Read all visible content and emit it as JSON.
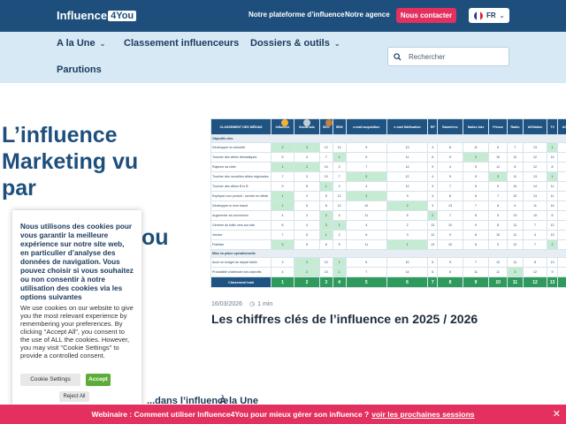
{
  "header": {
    "logo_text": "Influence",
    "logo_box": "4You",
    "links": [
      "Notre plateforme d’influence",
      "Notre agence"
    ],
    "contact_label": "Nous contacter",
    "lang_label": "FR",
    "colors": {
      "bar": "#1e4f7c",
      "accent": "#e3305f"
    }
  },
  "nav": {
    "items": [
      {
        "label": "A la Une",
        "has_dropdown": true
      },
      {
        "label": "Classement influenceurs",
        "has_dropdown": false
      },
      {
        "label": "Dossiers & outils",
        "has_dropdown": true
      },
      {
        "label": "Parutions",
        "has_dropdown": false
      }
    ],
    "search_placeholder": "Rechercher"
  },
  "hero": {
    "title_lines": [
      "L’influence",
      "Marketing vu",
      "par"
    ],
    "title_tail": "ou"
  },
  "article": {
    "date": "16/03/2026",
    "read_time": "1 min",
    "title": "Les chiffres clés de l’influence en 2025 / 2026",
    "table": {
      "headers": [
        "CLASSEMENT DES MÉDIAS",
        "Influence",
        "Social ads",
        "SEO",
        "SEM",
        "e-mail acquisition",
        "e-mail fidélisation",
        "RP",
        "Bannières",
        "Native Ads",
        "Presse",
        "Radio",
        "Affiliation",
        "TV",
        "Affichage"
      ],
      "section1": "Objectifs clés",
      "rows1": [
        {
          "label": "Développer la notoriété",
          "values": [
            "2",
            "3",
            "12",
            "10",
            "9",
            "13",
            "4",
            "8",
            "11",
            "5",
            "7",
            "13",
            "1",
            "6"
          ],
          "green": [
            0,
            1,
            12
          ]
        },
        {
          "label": "Toucher des cibles thématiques",
          "values": [
            "5",
            "4",
            "7",
            "1",
            "5",
            "11",
            "5",
            "9",
            "2",
            "10",
            "11",
            "12",
            "14",
            "15"
          ],
          "green": [
            3,
            8
          ]
        },
        {
          "label": "Rajeunir sa cible",
          "values": [
            "1",
            "2",
            "10",
            "3",
            "7",
            "14",
            "9",
            "4",
            "5",
            "11",
            "6",
            "12",
            "8",
            "13"
          ],
          "green": [
            0,
            1
          ]
        },
        {
          "label": "Toucher des nouvelles cibles régionales",
          "values": [
            "7",
            "3",
            "10",
            "7",
            "3",
            "12",
            "4",
            "9",
            "5",
            "3",
            "11",
            "13",
            "1",
            "14"
          ],
          "green": [
            4,
            9,
            12
          ]
        },
        {
          "label": "Toucher des cibles B to B",
          "values": [
            "9",
            "8",
            "1",
            "2",
            "4",
            "12",
            "3",
            "7",
            "6",
            "5",
            "10",
            "14",
            "11",
            "13"
          ],
          "green": [
            2
          ]
        },
        {
          "label": "Expliquer son produit - service en détail",
          "values": [
            "1",
            "2",
            "5",
            "12",
            "3",
            "9",
            "4",
            "8",
            "6",
            "7",
            "10",
            "13",
            "11",
            "14"
          ],
          "green": [
            0,
            4
          ]
        },
        {
          "label": "Développer le love brand",
          "values": [
            "1",
            "5",
            "8",
            "12",
            "10",
            "2",
            "3",
            "13",
            "7",
            "6",
            "4",
            "11",
            "14",
            "9"
          ],
          "green": [
            0,
            5
          ]
        },
        {
          "label": "Augmenter sa conversion",
          "values": [
            "4",
            "3",
            "2",
            "4",
            "11",
            "5",
            "2",
            "7",
            "8",
            "9",
            "13",
            "10",
            "6",
            "12"
          ],
          "green": [
            2,
            6
          ]
        },
        {
          "label": "Générer du trafic vers son site",
          "values": [
            "6",
            "4",
            "3",
            "1",
            "4",
            "2",
            "13",
            "10",
            "9",
            "8",
            "11",
            "7",
            "12",
            "14"
          ],
          "green": [
            2,
            3
          ]
        },
        {
          "label": "Vendre",
          "values": [
            "7",
            "5",
            "1",
            "2",
            "6",
            "3",
            "12",
            "9",
            "8",
            "10",
            "11",
            "4",
            "13",
            "14"
          ],
          "green": [
            2
          ]
        },
        {
          "label": "Fidéliser",
          "values": [
            "3",
            "5",
            "6",
            "5",
            "11",
            "1",
            "13",
            "10",
            "8",
            "9",
            "12",
            "7",
            "2",
            "14"
          ],
          "green": [
            0,
            5,
            12
          ]
        }
      ],
      "section2": "Mise en place opérationnelle",
      "rows2": [
        {
          "label": "Avoir un budget de départ faible",
          "values": [
            "3",
            "2",
            "12",
            "1",
            "6",
            "10",
            "5",
            "9",
            "7",
            "12",
            "11",
            "8",
            "13",
            "14"
          ],
          "green": [
            1,
            3
          ]
        },
        {
          "label": "Probabilité d'atteindre ses objectifs",
          "values": [
            "4",
            "2",
            "10",
            "1",
            "7",
            "14",
            "6",
            "8",
            "11",
            "11",
            "3",
            "12",
            "9",
            "13"
          ],
          "green": [
            1,
            3,
            10
          ]
        }
      ],
      "total_label": "Classement total",
      "total_values": [
        "1",
        "2",
        "3",
        "4",
        "5",
        "6",
        "7",
        "8",
        "9",
        "10",
        "11",
        "12",
        "13",
        "14"
      ]
    }
  },
  "cookie": {
    "strong_text": "Nous utilisons des cookies pour vous garantir la meilleure expérience sur notre site web, en particulier d’analyse des données de navigation. Vous pouvez choisir si vous souhaitez ou non consentir à notre utilisation des cookies via les options suivantes",
    "body_text": "We use cookies on our website to give you the most relevant experience by remembering your preferences. By clicking \"Accept All\", you consent to the use of ALL the cookies. However, you may visit \"Cookie Settings\" to provide a controlled consent.",
    "settings_label": "Cookie Settings",
    "accept_label": "Accept",
    "reject_label": "Reject All"
  },
  "lower": {
    "left_partial": "...dans l’influence",
    "mid_partial": "À la Une"
  },
  "banner": {
    "text": "Webinaire : Comment utiliser Influence4You pour mieux gérer son influence ?",
    "link": "voir les prochaines sessions",
    "close": "✕"
  }
}
